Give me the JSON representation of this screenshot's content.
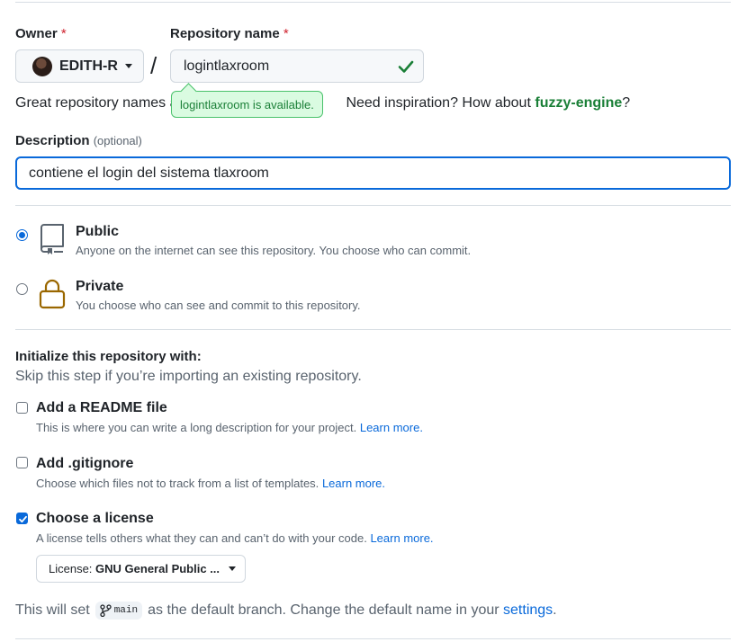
{
  "owner": {
    "label": "Owner",
    "required_mark": "*",
    "name": "EDITH-R"
  },
  "repo": {
    "label": "Repository name",
    "required_mark": "*",
    "value": "logintlaxroom",
    "separator": "/"
  },
  "availability": {
    "tooltip": "logintlaxroom is available."
  },
  "hint": {
    "prefix": "Great repository names a",
    "middle": "Need inspiration? How about",
    "suggestion": "fuzzy-engine",
    "suffix": "?"
  },
  "description": {
    "label": "Description",
    "optional": "(optional)",
    "value": "contiene el login del sistema tlaxroom"
  },
  "visibility": {
    "public": {
      "title": "Public",
      "sub": "Anyone on the internet can see this repository. You choose who can commit.",
      "selected": true
    },
    "private": {
      "title": "Private",
      "sub": "You choose who can see and commit to this repository.",
      "selected": false
    }
  },
  "init": {
    "title": "Initialize this repository with:",
    "sub": "Skip this step if you’re importing an existing repository.",
    "readme": {
      "title": "Add a README file",
      "sub": "This is where you can write a long description for your project.",
      "link": "Learn more.",
      "checked": false
    },
    "gitignore": {
      "title": "Add .gitignore",
      "sub": "Choose which files not to track from a list of templates.",
      "link": "Learn more.",
      "checked": false
    },
    "license": {
      "title": "Choose a license",
      "sub": "A license tells others what they can and can’t do with your code.",
      "link": "Learn more.",
      "checked": true,
      "select_prefix": "License:",
      "select_value": "GNU General Public ..."
    }
  },
  "footer": {
    "prefix": "This will set",
    "branch": "main",
    "middle": "as the default branch. Change the default name in your",
    "link": "settings",
    "suffix": "."
  },
  "colors": {
    "accent": "#0969da",
    "success": "#1a7f37",
    "danger": "#cf222e",
    "lock": "#9a6700"
  },
  "icons": {
    "check": "check-icon",
    "repo": "repo-icon",
    "lock": "lock-icon",
    "branch": "git-branch-icon",
    "caret": "triangle-down-icon"
  }
}
